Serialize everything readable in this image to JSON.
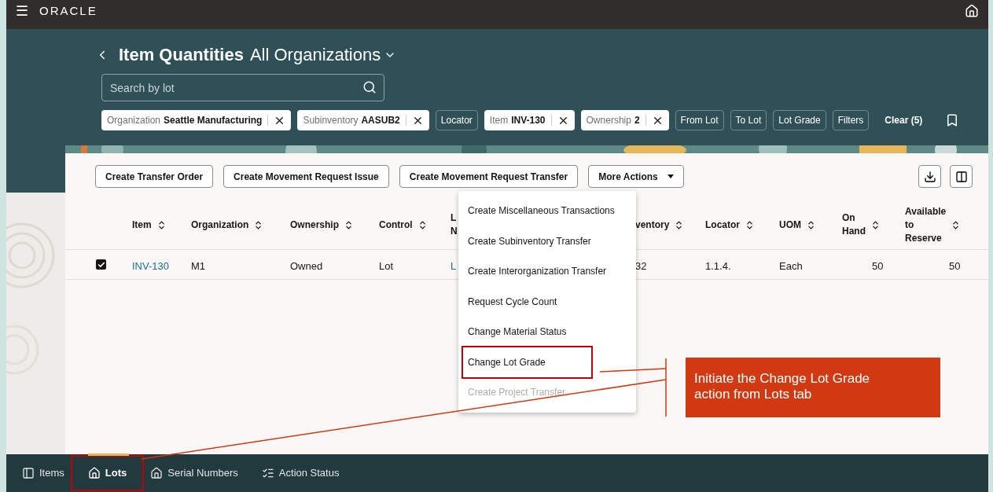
{
  "header": {
    "menu_glyph": "☰",
    "logo": "ORACLE"
  },
  "page": {
    "title": "Item Quantities",
    "scope": "All Organizations"
  },
  "search": {
    "placeholder": "Search by lot"
  },
  "filters": [
    {
      "kind": "chip",
      "label": "Organization",
      "value": "Seattle Manufacturing"
    },
    {
      "kind": "chip",
      "label": "Subinventory",
      "value": "AASUB2"
    },
    {
      "kind": "plain",
      "label": "Locator"
    },
    {
      "kind": "chip",
      "label": "Item",
      "value": "INV-130"
    },
    {
      "kind": "chip",
      "label": "Ownership",
      "value": "2"
    },
    {
      "kind": "plain",
      "label": "From Lot"
    },
    {
      "kind": "plain",
      "label": "To Lot"
    },
    {
      "kind": "plain",
      "label": "Lot Grade"
    },
    {
      "kind": "plain",
      "label": "Filters"
    }
  ],
  "clear": "Clear (5)",
  "actions": [
    "Create Transfer Order",
    "Create Movement Request Issue",
    "Create Movement Request Transfer"
  ],
  "more_actions": "More Actions",
  "table": {
    "columns": [
      {
        "lines": [
          "Item"
        ],
        "sort": true
      },
      {
        "lines": [
          "Organization"
        ],
        "sort": true
      },
      {
        "lines": [
          "Ownership"
        ],
        "sort": true
      },
      {
        "lines": [
          "Control"
        ],
        "sort": true
      },
      {
        "lines": [
          "L",
          "N"
        ],
        "sort": false
      },
      {
        "lines": [
          "ventory"
        ],
        "sort": true
      },
      {
        "lines": [
          "Locator"
        ],
        "sort": true
      },
      {
        "lines": [
          "UOM"
        ],
        "sort": true
      },
      {
        "lines": [
          "On",
          "Hand"
        ],
        "sort": true
      },
      {
        "lines": [
          "Available",
          "to",
          "Reserve"
        ],
        "sort": true
      }
    ],
    "rows": [
      {
        "selected": true,
        "cells": [
          "INV-130",
          "M1",
          "Owned",
          "Lot",
          "L",
          "32",
          "1.1.4.",
          "Each",
          "50",
          "50"
        ]
      }
    ]
  },
  "menu": [
    {
      "label": "Create Miscellaneous Transactions",
      "disabled": false,
      "highlighted": false
    },
    {
      "label": "Create Subinventory Transfer",
      "disabled": false,
      "highlighted": false
    },
    {
      "label": "Create Interorganization Transfer",
      "disabled": false,
      "highlighted": false
    },
    {
      "label": "Request Cycle Count",
      "disabled": false,
      "highlighted": false
    },
    {
      "label": "Change Material Status",
      "disabled": false,
      "highlighted": false
    },
    {
      "label": "Change Lot Grade",
      "disabled": false,
      "highlighted": true
    },
    {
      "label": "Create Project Transfer",
      "disabled": true,
      "highlighted": false
    }
  ],
  "callout": "Initiate the Change Lot Grade action from Lots tab",
  "tabs": [
    {
      "label": "Items",
      "selected": false,
      "highlighted": false
    },
    {
      "label": "Lots",
      "selected": true,
      "highlighted": true
    },
    {
      "label": "Serial Numbers",
      "selected": false,
      "highlighted": false
    },
    {
      "label": "Action Status",
      "selected": false,
      "highlighted": false
    }
  ]
}
